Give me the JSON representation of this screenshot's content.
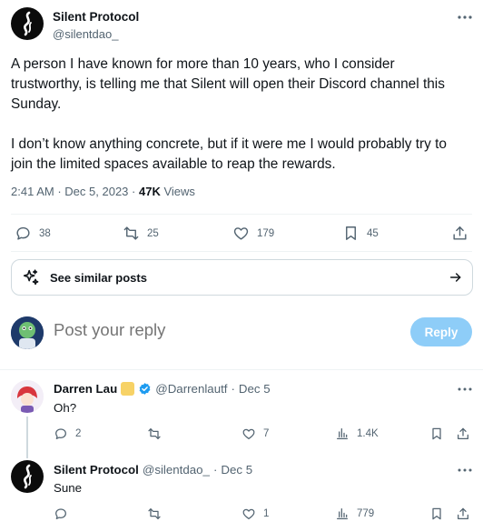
{
  "post": {
    "author_name": "Silent Protocol",
    "author_handle": "@silentdao_",
    "paragraph1": "A person I have known for more than 10 years, who I consider trustworthy, is telling me that Silent will open their Discord channel this Sunday.",
    "paragraph2": "I don’t know anything concrete, but if it were me I would probably try to join the limited spaces available to reap the rewards.",
    "time": "2:41 AM",
    "date": "Dec 5, 2023",
    "views_count": "47K",
    "views_label": "Views",
    "separator": "·"
  },
  "actions": {
    "replies": "38",
    "reposts": "25",
    "likes": "179",
    "bookmarks": "45"
  },
  "similar_posts": {
    "label": "See similar posts"
  },
  "composer": {
    "placeholder": "Post your reply",
    "reply_label": "Reply"
  },
  "replies": [
    {
      "name": "Darren Lau",
      "handle": "@Darrenlautf",
      "date": "Dec 5",
      "text": "Oh?",
      "replies": "2",
      "reposts": "",
      "likes": "7",
      "views": "1.4K"
    },
    {
      "name": "Silent Protocol",
      "handle": "@silentdao_",
      "date": "Dec 5",
      "text": "Sune",
      "replies": "",
      "reposts": "",
      "likes": "1",
      "views": "779"
    }
  ],
  "colors": {
    "text": "#0f1419",
    "muted": "#536471",
    "reply_button": "#8ecdf8",
    "verified": "#1d9bf0",
    "gold_badge": "#f7d266"
  },
  "icons": {
    "more": "more-icon",
    "reply": "reply-icon",
    "repost": "repost-icon",
    "like": "heart-icon",
    "bookmark": "bookmark-icon",
    "share": "share-icon",
    "views": "analytics-icon",
    "sparkle": "sparkle-icon",
    "arrow": "arrow-right-icon",
    "verified": "verified-badge-icon"
  }
}
